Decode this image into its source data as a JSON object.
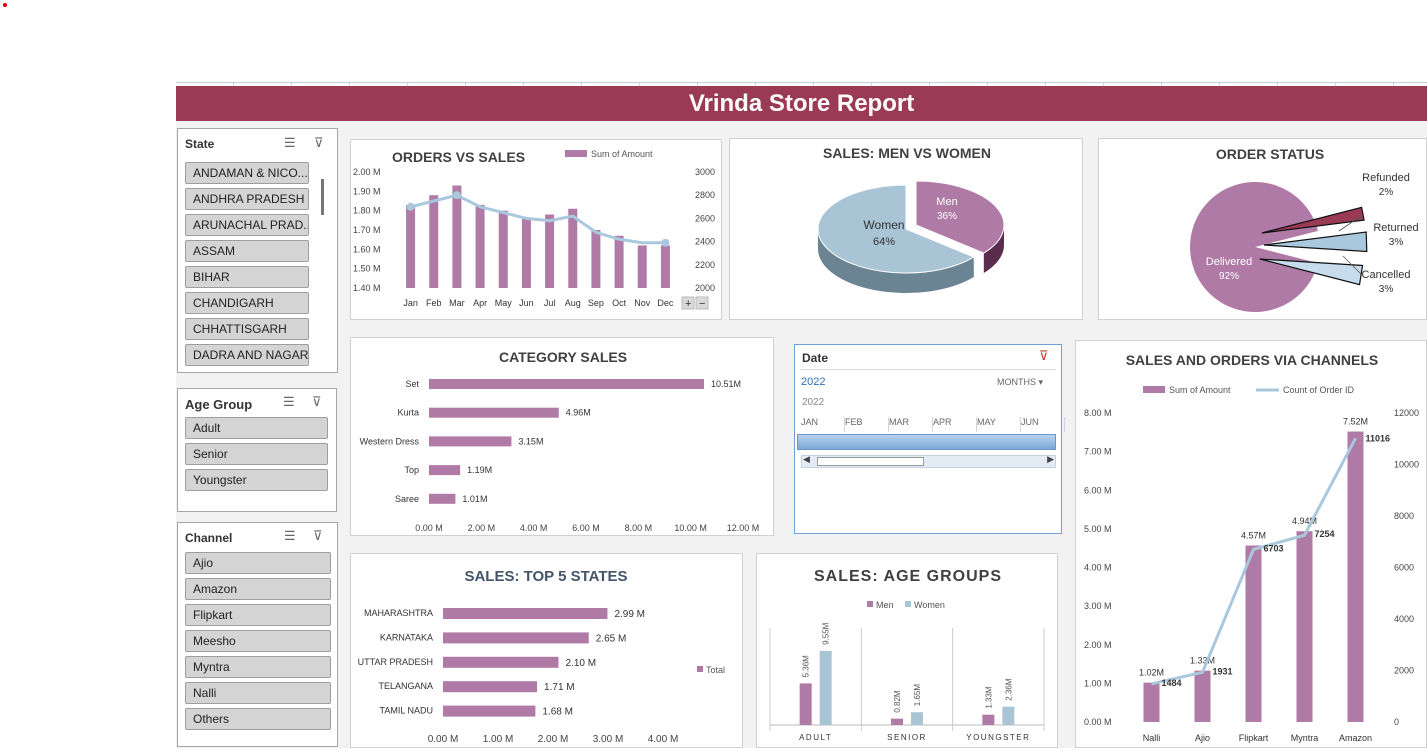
{
  "report": {
    "title": "Vrinda Store Report"
  },
  "colors": {
    "header": "#9b3a55",
    "bar": "#b07aa6",
    "line": "#a9c8dd",
    "women": "#a9c4d4"
  },
  "slicers": {
    "state": {
      "title": "State",
      "items": [
        "ANDAMAN & NICO...",
        "ANDHRA PRADESH",
        "ARUNACHAL PRAD...",
        "ASSAM",
        "BIHAR",
        "CHANDIGARH",
        "CHHATTISGARH",
        "DADRA AND NAGAR"
      ]
    },
    "age_group": {
      "title": "Age Group",
      "items": [
        "Adult",
        "Senior",
        "Youngster"
      ]
    },
    "channel": {
      "title": "Channel",
      "items": [
        "Ajio",
        "Amazon",
        "Flipkart",
        "Meesho",
        "Myntra",
        "Nalli",
        "Others"
      ]
    }
  },
  "timeline": {
    "title": "Date",
    "year": "2022",
    "year_sub": "2022",
    "level": "MONTHS",
    "months": [
      "JAN",
      "FEB",
      "MAR",
      "APR",
      "MAY",
      "JUN"
    ]
  },
  "chart_data": [
    {
      "id": "orders_vs_sales",
      "type": "bar",
      "title": "ORDERS VS SALES",
      "legend": [
        "Sum of Amount"
      ],
      "categories": [
        "Jan",
        "Feb",
        "Mar",
        "Apr",
        "May",
        "Jun",
        "Jul",
        "Aug",
        "Sep",
        "Oct",
        "Nov",
        "Dec"
      ],
      "series": [
        {
          "name": "Sum of Amount",
          "values": [
            1.83,
            1.88,
            1.93,
            1.83,
            1.8,
            1.76,
            1.78,
            1.81,
            1.7,
            1.67,
            1.62,
            1.62
          ]
        },
        {
          "values": [
            2700,
            2750,
            2800,
            2700,
            2650,
            2600,
            2580,
            2620,
            2480,
            2420,
            2390,
            2390
          ]
        }
      ],
      "y_left_ticks": [
        "2.00 M",
        "1.90 M",
        "1.80 M",
        "1.70 M",
        "1.60 M",
        "1.50 M",
        "1.40 M"
      ],
      "y_right_ticks": [
        "3000",
        "2800",
        "2600",
        "2400",
        "2200",
        "2000"
      ],
      "ylim_left": [
        1.4,
        2.0
      ],
      "ylim_right": [
        2000,
        3000
      ]
    },
    {
      "id": "sales_men_women",
      "type": "pie",
      "title": "SALES: MEN VS WOMEN",
      "slices": [
        {
          "label": "Women",
          "pct_label": "64%",
          "value": 64
        },
        {
          "label": "Men",
          "pct_label": "36%",
          "value": 36
        }
      ]
    },
    {
      "id": "order_status",
      "type": "pie",
      "title": "ORDER STATUS",
      "slices": [
        {
          "label": "Delivered",
          "pct_label": "92%",
          "value": 92
        },
        {
          "label": "Refunded",
          "pct_label": "2%",
          "value": 2
        },
        {
          "label": "Returned",
          "pct_label": "3%",
          "value": 3
        },
        {
          "label": "Cancelled",
          "pct_label": "3%",
          "value": 3
        }
      ]
    },
    {
      "id": "category_sales",
      "type": "bar",
      "title": "CATEGORY SALES",
      "categories": [
        "Set",
        "Kurta",
        "Western Dress",
        "Top",
        "Saree"
      ],
      "values": [
        10.51,
        4.96,
        3.15,
        1.19,
        1.01
      ],
      "labels": [
        "10.51M",
        "4.96M",
        "3.15M",
        "1.19M",
        "1.01M"
      ],
      "x_ticks": [
        "0.00 M",
        "2.00 M",
        "4.00 M",
        "6.00 M",
        "8.00 M",
        "10.00 M",
        "12.00 M"
      ],
      "xlim": [
        0,
        12
      ]
    },
    {
      "id": "top5_states",
      "type": "bar",
      "title": "SALES: TOP 5 STATES",
      "legend": [
        "Total"
      ],
      "categories": [
        "MAHARASHTRA",
        "KARNATAKA",
        "UTTAR PRADESH",
        "TELANGANA",
        "TAMIL NADU"
      ],
      "values": [
        2.99,
        2.65,
        2.1,
        1.71,
        1.68
      ],
      "labels": [
        "2.99 M",
        "2.65 M",
        "2.10 M",
        "1.71 M",
        "1.68 M"
      ],
      "x_ticks": [
        "0.00 M",
        "1.00 M",
        "2.00 M",
        "3.00 M",
        "4.00 M"
      ],
      "xlim": [
        0,
        4
      ]
    },
    {
      "id": "age_groups",
      "type": "bar",
      "title": "SALES: AGE GROUPS",
      "legend": [
        "Men",
        "Women"
      ],
      "categories": [
        "ADULT",
        "SENIOR",
        "YOUNGSTER"
      ],
      "series": [
        {
          "name": "Men",
          "values": [
            5.36,
            0.82,
            1.33
          ],
          "labels": [
            "5.36M",
            "0.82M",
            "1.33M"
          ]
        },
        {
          "name": "Women",
          "values": [
            9.55,
            1.65,
            2.36
          ],
          "labels": [
            "9.55M",
            "1.65M",
            "2.36M"
          ]
        }
      ],
      "ylim": [
        0,
        12.5
      ]
    },
    {
      "id": "channels",
      "type": "bar",
      "title": "SALES AND ORDERS VIA CHANNELS",
      "legend": [
        "Sum of Amount",
        "Count of Order ID"
      ],
      "categories": [
        "Nalli",
        "Ajio",
        "Flipkart",
        "Myntra",
        "Amazon"
      ],
      "series": [
        {
          "name": "Sum of Amount",
          "values": [
            1.02,
            1.33,
            4.57,
            4.94,
            7.52
          ],
          "labels": [
            "1.02M",
            "1.33M",
            "4.57M",
            "4.94M",
            "7.52M"
          ]
        },
        {
          "name": "Count of Order ID",
          "values": [
            1484,
            1931,
            6703,
            7254,
            11016
          ],
          "labels": [
            "1484",
            "1931",
            "6703",
            "7254",
            "11016"
          ]
        }
      ],
      "y_left_ticks": [
        "8.00 M",
        "7.00 M",
        "6.00 M",
        "5.00 M",
        "4.00 M",
        "3.00 M",
        "2.00 M",
        "1.00 M",
        "0.00 M"
      ],
      "y_right_ticks": [
        "12000",
        "10000",
        "8000",
        "6000",
        "4000",
        "2000",
        "0"
      ],
      "ylim_left": [
        0,
        8
      ],
      "ylim_right": [
        0,
        12000
      ]
    }
  ]
}
